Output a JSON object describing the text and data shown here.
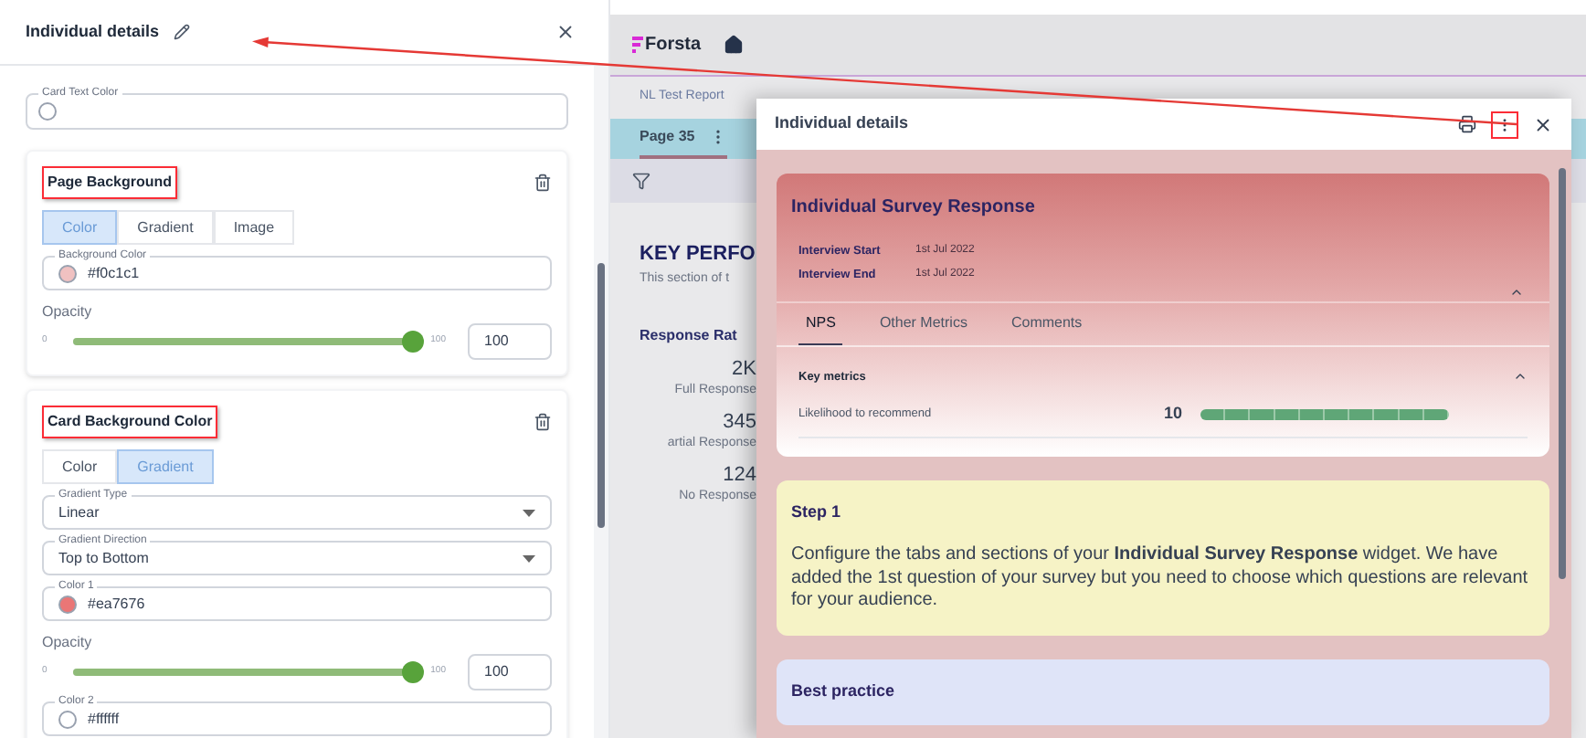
{
  "left_panel": {
    "title": "Individual details",
    "card_text_color": {
      "label": "Card Text Color",
      "color": "#ffffff"
    },
    "sections": [
      {
        "title": "Page Background",
        "highlighted": true,
        "tabs": [
          {
            "label": "Color",
            "selected": true
          },
          {
            "label": "Gradient",
            "selected": false
          },
          {
            "label": "Image",
            "selected": false
          }
        ],
        "fields": [
          {
            "kind": "color",
            "label": "Background Color",
            "value": "#f0c1c1",
            "color": "#f0c1c1"
          },
          {
            "kind": "opacity",
            "label": "Opacity",
            "min": "0",
            "max": "100",
            "level": 1,
            "value": "100"
          }
        ]
      },
      {
        "title": "Card Background Color",
        "highlighted": true,
        "tabs": [
          {
            "label": "Color",
            "selected": false
          },
          {
            "label": "Gradient",
            "selected": true
          }
        ],
        "fields": [
          {
            "kind": "select",
            "label": "Gradient Type",
            "value": "Linear"
          },
          {
            "kind": "select",
            "label": "Gradient Direction",
            "value": "Top to Bottom"
          },
          {
            "kind": "color",
            "label": "Color 1",
            "value": "#ea7676",
            "color": "#ea7676"
          },
          {
            "kind": "opacity",
            "label": "Opacity",
            "min": "0",
            "max": "100",
            "level": 1,
            "value": "100"
          },
          {
            "kind": "color",
            "label": "Color 2",
            "value": "#ffffff",
            "color": "#ffffff"
          }
        ]
      }
    ]
  },
  "report": {
    "logo": "Forsta",
    "breadcrumb": "NL Test Report",
    "page_tab": {
      "label": "Page 35",
      "selected": true
    },
    "heading": "KEY PERFO",
    "subheading": "This section of t",
    "stats_title": "Response Rat",
    "stats": [
      {
        "value": "2K",
        "label": "Full Response"
      },
      {
        "value": "345",
        "label": "artial Response"
      },
      {
        "value": "124",
        "label": "No Response"
      }
    ]
  },
  "modal": {
    "title": "Individual details",
    "more_highlighted": true,
    "card": {
      "title": "Individual Survey Response",
      "expanded": true,
      "meta": [
        {
          "label": "Interview Start",
          "value": "1st Jul 2022"
        },
        {
          "label": "Interview End",
          "value": "1st Jul 2022"
        }
      ],
      "tabs": [
        {
          "label": "NPS",
          "selected": true
        },
        {
          "label": "Other Metrics",
          "selected": false
        },
        {
          "label": "Comments",
          "selected": false
        }
      ],
      "section": {
        "title": "Key metrics",
        "expanded": true,
        "metrics": [
          {
            "label": "Likelihood to recommend",
            "value": "10",
            "level": 1
          }
        ]
      }
    },
    "notes": [
      {
        "kind": "step",
        "title": "Step 1",
        "text": "Configure the tabs and sections of your **Individual Survey Response** widget. We have added the 1st question of your survey but you need to choose which questions are relevant for your audience."
      },
      {
        "kind": "tip",
        "title": "Best practice"
      }
    ]
  }
}
